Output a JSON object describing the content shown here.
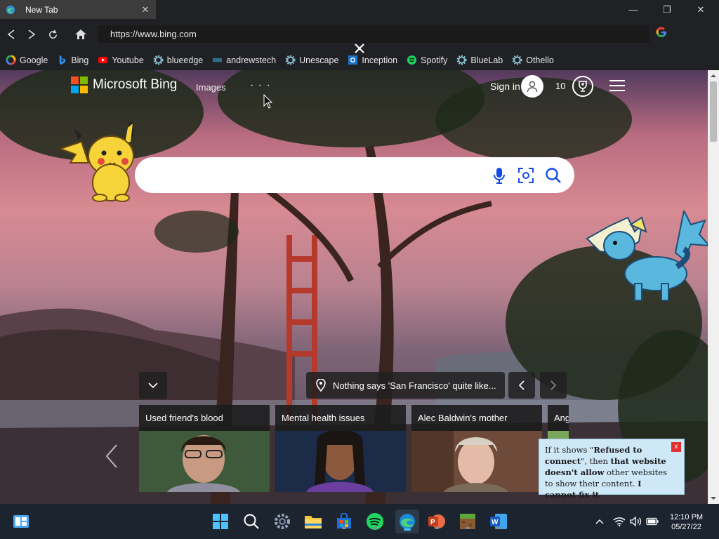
{
  "tab": {
    "title": "New Tab",
    "close": "✕"
  },
  "window": {
    "minimize": "—",
    "maximize": "❐",
    "close": "✕"
  },
  "address": {
    "url": "https://www.bing.com"
  },
  "bookmarks": [
    {
      "label": "Google",
      "icon": "google-icon"
    },
    {
      "label": "Bing",
      "icon": "bing-icon"
    },
    {
      "label": "Youtube",
      "icon": "youtube-icon"
    },
    {
      "label": "blueedge",
      "icon": "gear-icon"
    },
    {
      "label": "andrewstech",
      "icon": "globe-icon"
    },
    {
      "label": "Unescape",
      "icon": "gear-icon"
    },
    {
      "label": "Inception",
      "icon": "square-icon"
    },
    {
      "label": "Spotify",
      "icon": "spotify-icon"
    },
    {
      "label": "BlueLab",
      "icon": "gear-icon"
    },
    {
      "label": "Othello",
      "icon": "gear-icon"
    }
  ],
  "bing": {
    "brand": "Microsoft Bing",
    "nav_images": "Images",
    "nav_more": "· · ·",
    "signin": "Sign in",
    "rewards_count": "10",
    "location_caption": "Nothing says 'San Francisco' quite like...",
    "news": [
      {
        "title": "Used friend's blood"
      },
      {
        "title": "Mental health issues"
      },
      {
        "title": "Alec Baldwin's mother"
      },
      {
        "title": "Ang"
      }
    ]
  },
  "tooltip": {
    "part1": "If it shows \"",
    "bold1": "Refused to connect",
    "part2": "\", then ",
    "bold2": "that website doesn't allow",
    "part3": " other websites to show their content. ",
    "bold3": "I cannot fix it",
    "part4": ".",
    "close": "x"
  },
  "taskbar": {
    "apps": [
      "widgets-icon",
      "start-icon",
      "search-icon",
      "settings-icon",
      "file-explorer-icon",
      "store-icon",
      "spotify-icon",
      "edge-icon",
      "powerpoint-icon",
      "minecraft-icon",
      "word-icon"
    ],
    "time": "12:10 PM",
    "date": "05/27/22"
  },
  "colors": {
    "ms_red": "#f25022",
    "ms_green": "#7fba00",
    "ms_blue": "#00a4ef",
    "ms_yellow": "#ffb900",
    "tooltip_bg": "#cfe8f7"
  }
}
